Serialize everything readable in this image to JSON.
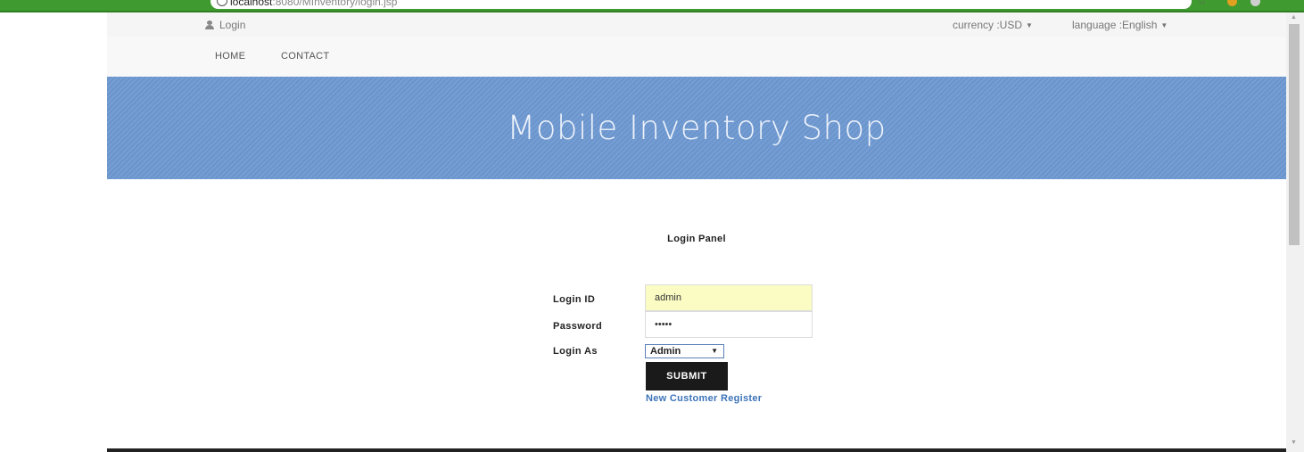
{
  "browser": {
    "url_host": "localhost",
    "url_path": ":8080/MInventory/login.jsp",
    "star_icon": "bookmark-star-icon"
  },
  "topbar": {
    "login_label": "Login",
    "currency_label": "currency :USD",
    "language_label": "language :English"
  },
  "nav": {
    "home": "HOME",
    "contact": "CONTACT"
  },
  "banner": {
    "title": "Mobile Inventory Shop",
    "color": "#6e99d2"
  },
  "login_panel": {
    "title": "Login Panel",
    "login_id_label": "Login ID",
    "login_id_value": "admin",
    "password_label": "Password",
    "password_value": "•••••",
    "login_as_label": "Login As",
    "login_as_value": "Admin",
    "submit_label": "SUBMIT",
    "register_link": "New Customer Register"
  },
  "colors": {
    "chrome_green": "#3f9a2f",
    "autofill_yellow": "#fafcc3",
    "submit_bg": "#1a1a1a",
    "link_blue": "#3d74b8"
  }
}
